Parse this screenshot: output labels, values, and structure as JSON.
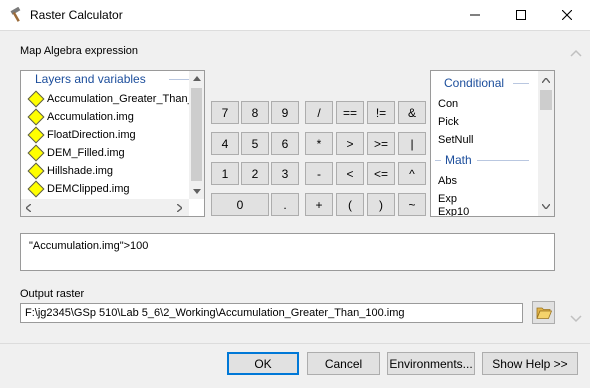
{
  "window": {
    "title": "Raster Calculator",
    "icon": "hammer-icon"
  },
  "map_algebra_label": "Map Algebra expression",
  "layers": {
    "header": "Layers and variables",
    "items": [
      "Accumulation_Greater_Than_",
      "Accumulation.img",
      "FloatDirection.img",
      "DEM_Filled.img",
      "Hillshade.img",
      "DEMClipped.img"
    ]
  },
  "keypad": {
    "row1": [
      "7",
      "8",
      "9",
      "/",
      "==",
      "!=",
      "&"
    ],
    "row2": [
      "4",
      "5",
      "6",
      "*",
      ">",
      ">=",
      "|"
    ],
    "row3": [
      "1",
      "2",
      "3",
      "-",
      "<",
      "<=",
      "^"
    ],
    "row4": [
      "0",
      ".",
      "+",
      "(",
      ")",
      "~"
    ]
  },
  "functions": {
    "group1": "Conditional",
    "group1_items": [
      "Con",
      "Pick",
      "SetNull"
    ],
    "group2": "Math",
    "group2_items": [
      "Abs",
      "Exp",
      "Exp10"
    ]
  },
  "expression": "\"Accumulation.img\">100",
  "output": {
    "label": "Output raster",
    "value": "F:\\jg2345\\GSp 510\\Lab 5_6\\2_Working\\Accumulation_Greater_Than_100.img",
    "browse_icon": "folder-open-icon"
  },
  "buttons": {
    "ok": "OK",
    "cancel": "Cancel",
    "environments": "Environments...",
    "show_help": "Show Help >>"
  },
  "colors": {
    "accent": "#0078d7",
    "group_header": "#1c4e9c",
    "layer_icon": "#ffff00"
  }
}
